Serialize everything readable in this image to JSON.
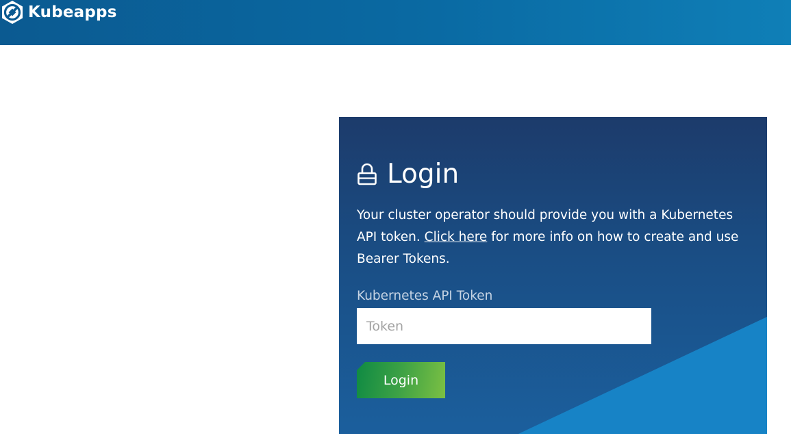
{
  "header": {
    "brand_name": "Kubeapps",
    "logo_icon": "kubeapps-logo-icon"
  },
  "login_card": {
    "title": "Login",
    "title_icon": "lock-icon",
    "description_before_link": "Your cluster operator should provide you with a Kubernetes API token. ",
    "link_text": "Click here",
    "description_after_link": " for more info on how to create and use Bearer Tokens.",
    "token_label": "Kubernetes API Token",
    "token_value": "",
    "token_placeholder": "Token",
    "submit_label": "Login"
  },
  "colors": {
    "header_start": "#0b5a91",
    "header_end": "#0f7fb7",
    "card_top": "#1c3b6b",
    "card_bottom": "#1b5f9d",
    "card_accent": "#1783c6",
    "button_start": "#0f8a43",
    "button_end": "#7cc043"
  }
}
